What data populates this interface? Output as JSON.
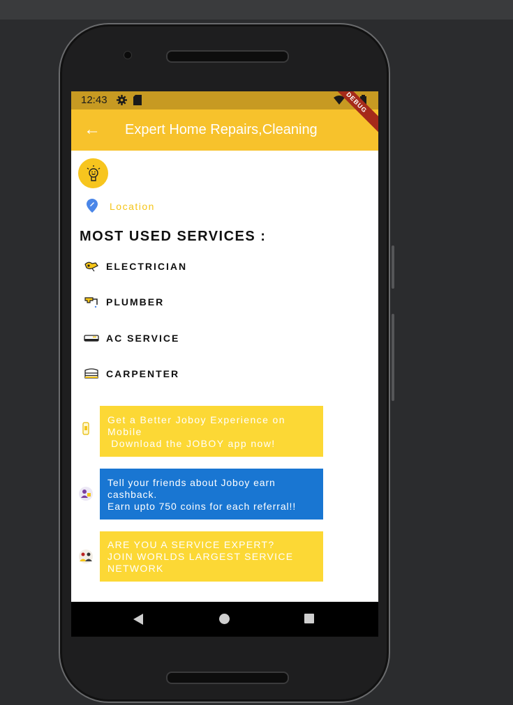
{
  "status_bar": {
    "time": "12:43",
    "debug_label": "DEBUG"
  },
  "app_bar": {
    "back_icon": "arrow-left-icon",
    "title": "Expert Home Repairs,Cleaning"
  },
  "location": {
    "icon": "location-pin-icon",
    "label": "Location"
  },
  "section_title": "MOST USED SERVICES :",
  "services": [
    {
      "label": "ELECTRICIAN",
      "icon": "electrician-icon"
    },
    {
      "label": "PLUMBER",
      "icon": "plumber-icon"
    },
    {
      "label": "AC SERVICE",
      "icon": "ac-icon"
    },
    {
      "label": "CARPENTER",
      "icon": "carpenter-icon"
    }
  ],
  "banners": [
    {
      "line1": "Get a Better Joboy Experience on",
      "line2": "Mobile",
      "line3": " Download the JOBOY app now!",
      "color": "#fcd835",
      "icon": "mobile-app-icon"
    },
    {
      "line1": "Tell your friends about Joboy earn",
      "line2": "cashback.",
      "line3": "Earn upto 750 coins for each referral!!",
      "color": "#1976d2",
      "icon": "referral-icon"
    },
    {
      "line1": "ARE YOU A SERVICE EXPERT?",
      "line2": "JOIN WORLDS LARGEST SERVICE",
      "line3": "NETWORK",
      "color": "#fcd835",
      "icon": "service-expert-icon"
    }
  ],
  "colors": {
    "accent": "#f7c22c",
    "status_bar": "#c79a22",
    "location_text": "#f5c518",
    "blue_banner": "#1976d2"
  }
}
